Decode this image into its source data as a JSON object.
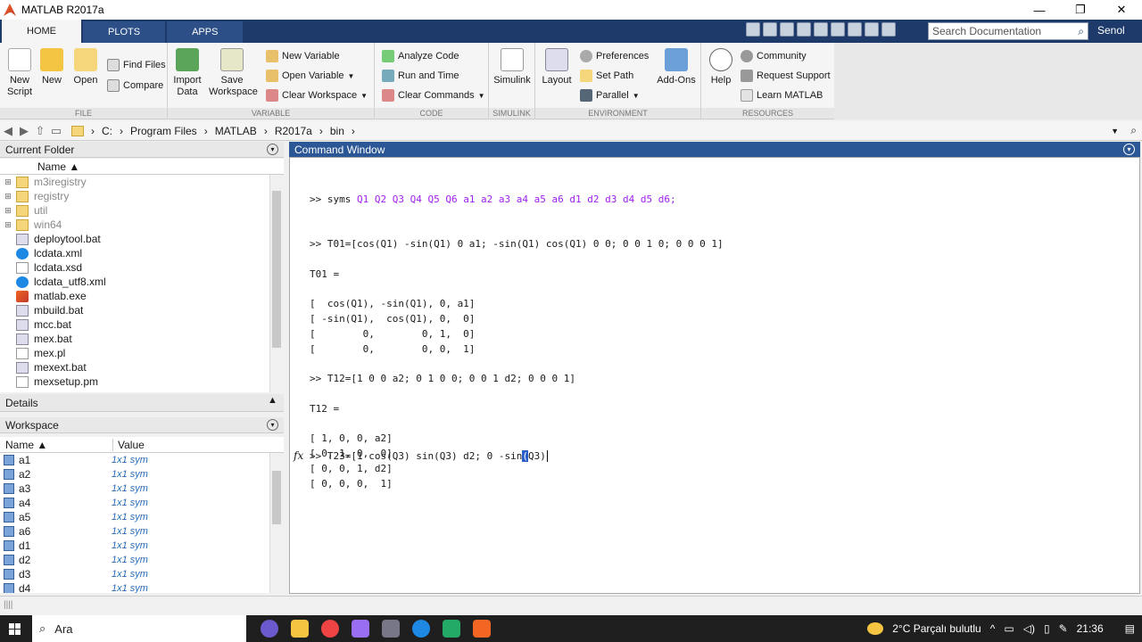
{
  "window": {
    "title": "MATLAB R2017a",
    "min": "—",
    "max": "❐",
    "close": "✕"
  },
  "tabs": [
    "HOME",
    "PLOTS",
    "APPS"
  ],
  "search": {
    "placeholder": "Search Documentation"
  },
  "user": "Senol",
  "ribbon": {
    "file": {
      "label": "FILE",
      "new_script": "New Script",
      "new": "New",
      "open": "Open",
      "find_files": "Find Files",
      "compare": "Compare"
    },
    "variable": {
      "label": "VARIABLE",
      "import_data": "Import Data",
      "save_workspace": "Save Workspace",
      "new_variable": "New Variable",
      "open_variable": "Open Variable",
      "clear_workspace": "Clear Workspace"
    },
    "code": {
      "label": "CODE",
      "analyze": "Analyze Code",
      "run_time": "Run and Time",
      "clear_commands": "Clear Commands"
    },
    "simulink": {
      "label": "SIMULINK",
      "simulink": "Simulink"
    },
    "environment": {
      "label": "ENVIRONMENT",
      "layout": "Layout",
      "preferences": "Preferences",
      "set_path": "Set Path",
      "parallel": "Parallel",
      "addons": "Add-Ons"
    },
    "resources": {
      "label": "RESOURCES",
      "help": "Help",
      "community": "Community",
      "request_support": "Request Support",
      "learn": "Learn MATLAB"
    }
  },
  "path": [
    "C:",
    "Program Files",
    "MATLAB",
    "R2017a",
    "bin"
  ],
  "current_folder": {
    "title": "Current Folder",
    "col_name": "Name ▲",
    "items": [
      {
        "name": "m3iregistry",
        "type": "folder",
        "exp": "⊞"
      },
      {
        "name": "registry",
        "type": "folder",
        "exp": "⊞"
      },
      {
        "name": "util",
        "type": "folder",
        "exp": "⊞"
      },
      {
        "name": "win64",
        "type": "folder",
        "exp": "⊞"
      },
      {
        "name": "deploytool.bat",
        "type": "bat",
        "exp": ""
      },
      {
        "name": "lcdata.xml",
        "type": "xml",
        "exp": ""
      },
      {
        "name": "lcdata.xsd",
        "type": "file",
        "exp": ""
      },
      {
        "name": "lcdata_utf8.xml",
        "type": "xml",
        "exp": ""
      },
      {
        "name": "matlab.exe",
        "type": "exe",
        "exp": ""
      },
      {
        "name": "mbuild.bat",
        "type": "bat",
        "exp": ""
      },
      {
        "name": "mcc.bat",
        "type": "bat",
        "exp": ""
      },
      {
        "name": "mex.bat",
        "type": "bat",
        "exp": ""
      },
      {
        "name": "mex.pl",
        "type": "file",
        "exp": ""
      },
      {
        "name": "mexext.bat",
        "type": "bat",
        "exp": ""
      },
      {
        "name": "mexsetup.pm",
        "type": "file",
        "exp": ""
      }
    ]
  },
  "details": {
    "title": "Details"
  },
  "workspace": {
    "title": "Workspace",
    "col_name": "Name ▲",
    "col_value": "Value",
    "items": [
      {
        "name": "a1",
        "value": "1x1 sym"
      },
      {
        "name": "a2",
        "value": "1x1 sym"
      },
      {
        "name": "a3",
        "value": "1x1 sym"
      },
      {
        "name": "a4",
        "value": "1x1 sym"
      },
      {
        "name": "a5",
        "value": "1x1 sym"
      },
      {
        "name": "a6",
        "value": "1x1 sym"
      },
      {
        "name": "d1",
        "value": "1x1 sym"
      },
      {
        "name": "d2",
        "value": "1x1 sym"
      },
      {
        "name": "d3",
        "value": "1x1 sym"
      },
      {
        "name": "d4",
        "value": "1x1 sym"
      }
    ]
  },
  "command_window": {
    "title": "Command Window",
    "line_syms_prompt": ">> syms ",
    "line_syms_vars": "Q1 Q2 Q3 Q4 Q5 Q6 a1 a2 a3 a4 a5 a6 d1 d2 d3 d4 d5 d6;",
    "lines": [
      ">> T01=[cos(Q1) -sin(Q1) 0 a1; -sin(Q1) cos(Q1) 0 0; 0 0 1 0; 0 0 0 1]",
      "",
      "T01 =",
      "",
      "[  cos(Q1), -sin(Q1), 0, a1]",
      "[ -sin(Q1),  cos(Q1), 0,  0]",
      "[        0,        0, 1,  0]",
      "[        0,        0, 0,  1]",
      "",
      ">> T12=[1 0 0 a2; 0 1 0 0; 0 0 1 d2; 0 0 0 1]",
      "",
      "T12 =",
      "",
      "[ 1, 0, 0, a2]",
      "[ 0, 1, 0,  0]",
      "[ 0, 0, 1, d2]",
      "[ 0, 0, 0,  1]",
      ""
    ],
    "input_before": ">> T23=[1 cos(Q3) sin(Q3) d2; 0 -sin",
    "input_selected": "(",
    "input_after": "Q3)",
    "fx": "fx"
  },
  "taskbar": {
    "search": "Ara",
    "weather": "2°C  Parçalı bulutlu",
    "time": "21:36"
  }
}
